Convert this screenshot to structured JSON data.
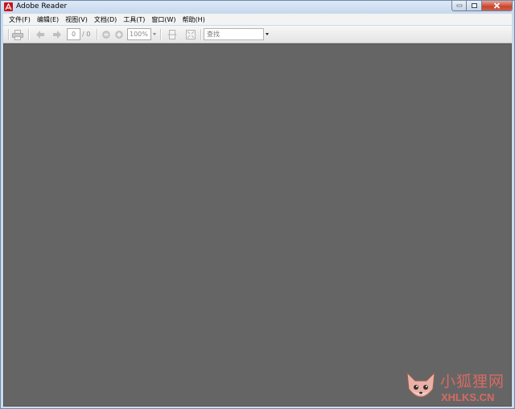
{
  "window": {
    "title": "Adobe Reader"
  },
  "menu": [
    "文件(F)",
    "编辑(E)",
    "视图(V)",
    "文档(D)",
    "工具(T)",
    "窗口(W)",
    "帮助(H)"
  ],
  "toolbar": {
    "page_current": "0",
    "page_total": "/ 0",
    "zoom": "100%",
    "search_placeholder": "查找"
  },
  "watermark": {
    "cn": "小狐狸网",
    "en": "XHLKS.CN"
  },
  "colors": {
    "viewer_bg": "#656565",
    "titlebar": "#c6d9ee",
    "watermark": "#d66b62",
    "app_logo": "#c4161c"
  }
}
